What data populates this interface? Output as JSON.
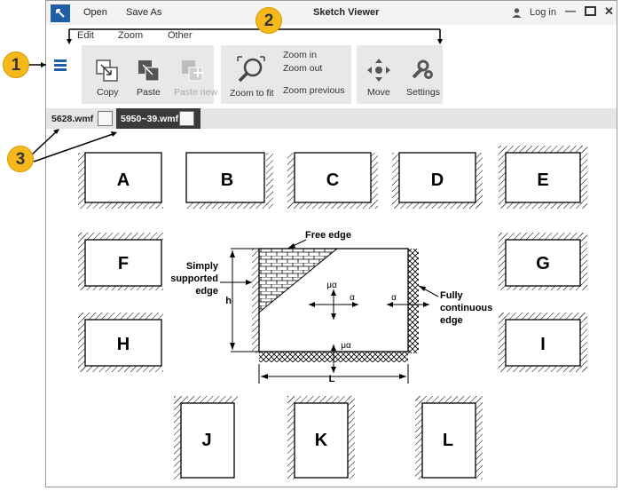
{
  "window": {
    "title": "Sketch Viewer",
    "menu_top": [
      "Open",
      "Save As"
    ],
    "login": "Log in",
    "menu_second": [
      "Edit",
      "Zoom",
      "Other"
    ]
  },
  "ribbon": {
    "edit": [
      "Copy",
      "Paste",
      "Paste new"
    ],
    "zoom_main": "Zoom to fit",
    "zoom_list": [
      "Zoom in",
      "Zoom out",
      "Zoom previous"
    ],
    "other": [
      "Move",
      "Settings"
    ]
  },
  "tabs": [
    {
      "label": "5628.wmf",
      "active": false
    },
    {
      "label": "5950~39.wmf",
      "active": true
    }
  ],
  "callouts": [
    "1",
    "2",
    "3"
  ],
  "sketch_boxes": [
    "A",
    "B",
    "C",
    "D",
    "E",
    "F",
    "G",
    "H",
    "I",
    "J",
    "K",
    "L"
  ],
  "diagram": {
    "free_edge": "Free edge",
    "simply_supported": [
      "Simply",
      "supported",
      "edge"
    ],
    "fully_continuous": [
      "Fully",
      "continuous",
      "edge"
    ],
    "h": "h",
    "L": "L",
    "mu_alpha": "μα",
    "alpha": "α"
  },
  "colors": {
    "accent": "#1f5fa8",
    "callout": "#f5b91b",
    "active_tab": "#3a3a3a"
  }
}
